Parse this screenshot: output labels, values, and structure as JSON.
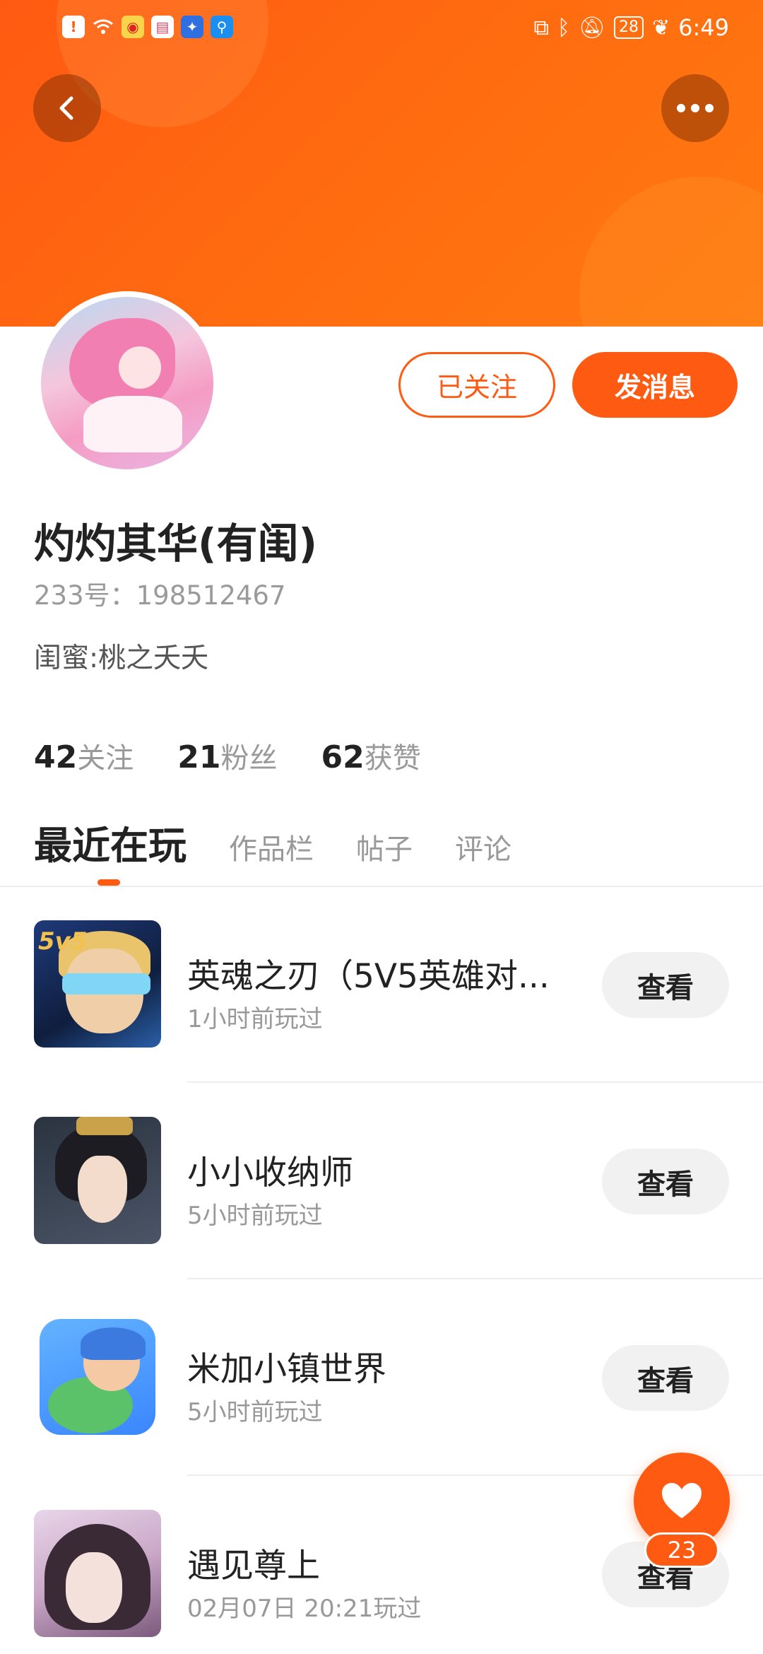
{
  "colors": {
    "accent": "#ff5a12",
    "muted_text": "#999999",
    "button_gray": "#f1f1f1"
  },
  "status_bar": {
    "time": "6:49",
    "battery": "28"
  },
  "header": {
    "back_icon": "chevron-left-icon",
    "more_icon": "more-dots-icon"
  },
  "profile": {
    "name": "灼灼其华(有闺)",
    "id_label": "233号：",
    "id_value": "198512467",
    "bio": "闺蜜:桃之夭夭",
    "follow_button": "已关注",
    "message_button": "发消息"
  },
  "stats": [
    {
      "num": "42",
      "label": "关注"
    },
    {
      "num": "21",
      "label": "粉丝"
    },
    {
      "num": "62",
      "label": "获赞"
    }
  ],
  "tabs": [
    "最近在玩",
    "作品栏",
    "帖子",
    "评论"
  ],
  "games": [
    {
      "title": "英魂之刃（5V5英雄对...",
      "time": "1小时前玩过",
      "button": "查看",
      "icon_badge": "5v5"
    },
    {
      "title": "小小收纳师",
      "time": "5小时前玩过",
      "button": "查看"
    },
    {
      "title": "米加小镇世界",
      "time": "5小时前玩过",
      "button": "查看"
    },
    {
      "title": "遇见尊上",
      "time": "02月07日 20:21玩过",
      "button": "查看"
    }
  ],
  "like_fab": {
    "count": "23",
    "icon": "heart-icon"
  }
}
